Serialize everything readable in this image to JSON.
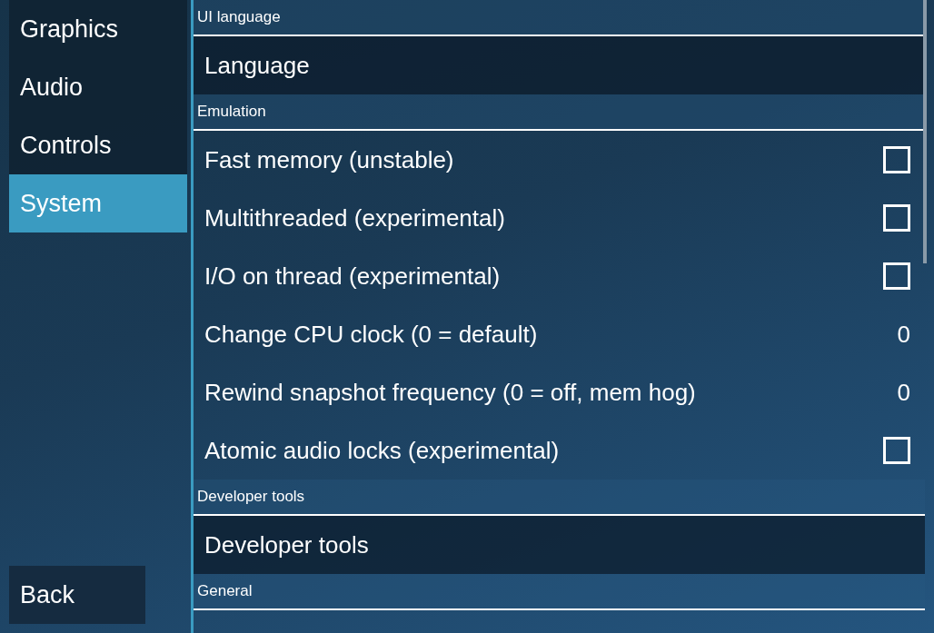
{
  "sidebar": {
    "items": [
      {
        "label": "Graphics",
        "selected": false
      },
      {
        "label": "Audio",
        "selected": false
      },
      {
        "label": "Controls",
        "selected": false
      },
      {
        "label": "System",
        "selected": true
      }
    ]
  },
  "back_button": "Back",
  "sections": [
    {
      "header": "UI language",
      "items": [
        {
          "kind": "choice",
          "label": "Language"
        }
      ]
    },
    {
      "header": "Emulation",
      "items": [
        {
          "kind": "checkbox",
          "label": "Fast memory (unstable)",
          "checked": false
        },
        {
          "kind": "checkbox",
          "label": "Multithreaded (experimental)",
          "checked": false
        },
        {
          "kind": "checkbox",
          "label": "I/O on thread (experimental)",
          "checked": false
        },
        {
          "kind": "value",
          "label": "Change CPU clock (0 = default)",
          "value": "0"
        },
        {
          "kind": "value",
          "label": "Rewind snapshot frequency (0 = off, mem hog)",
          "value": "0"
        },
        {
          "kind": "checkbox",
          "label": "Atomic audio locks (experimental)",
          "checked": false
        }
      ]
    },
    {
      "header": "Developer tools",
      "items": [
        {
          "kind": "choice",
          "label": "Developer tools"
        }
      ]
    },
    {
      "header": "General"
    }
  ]
}
